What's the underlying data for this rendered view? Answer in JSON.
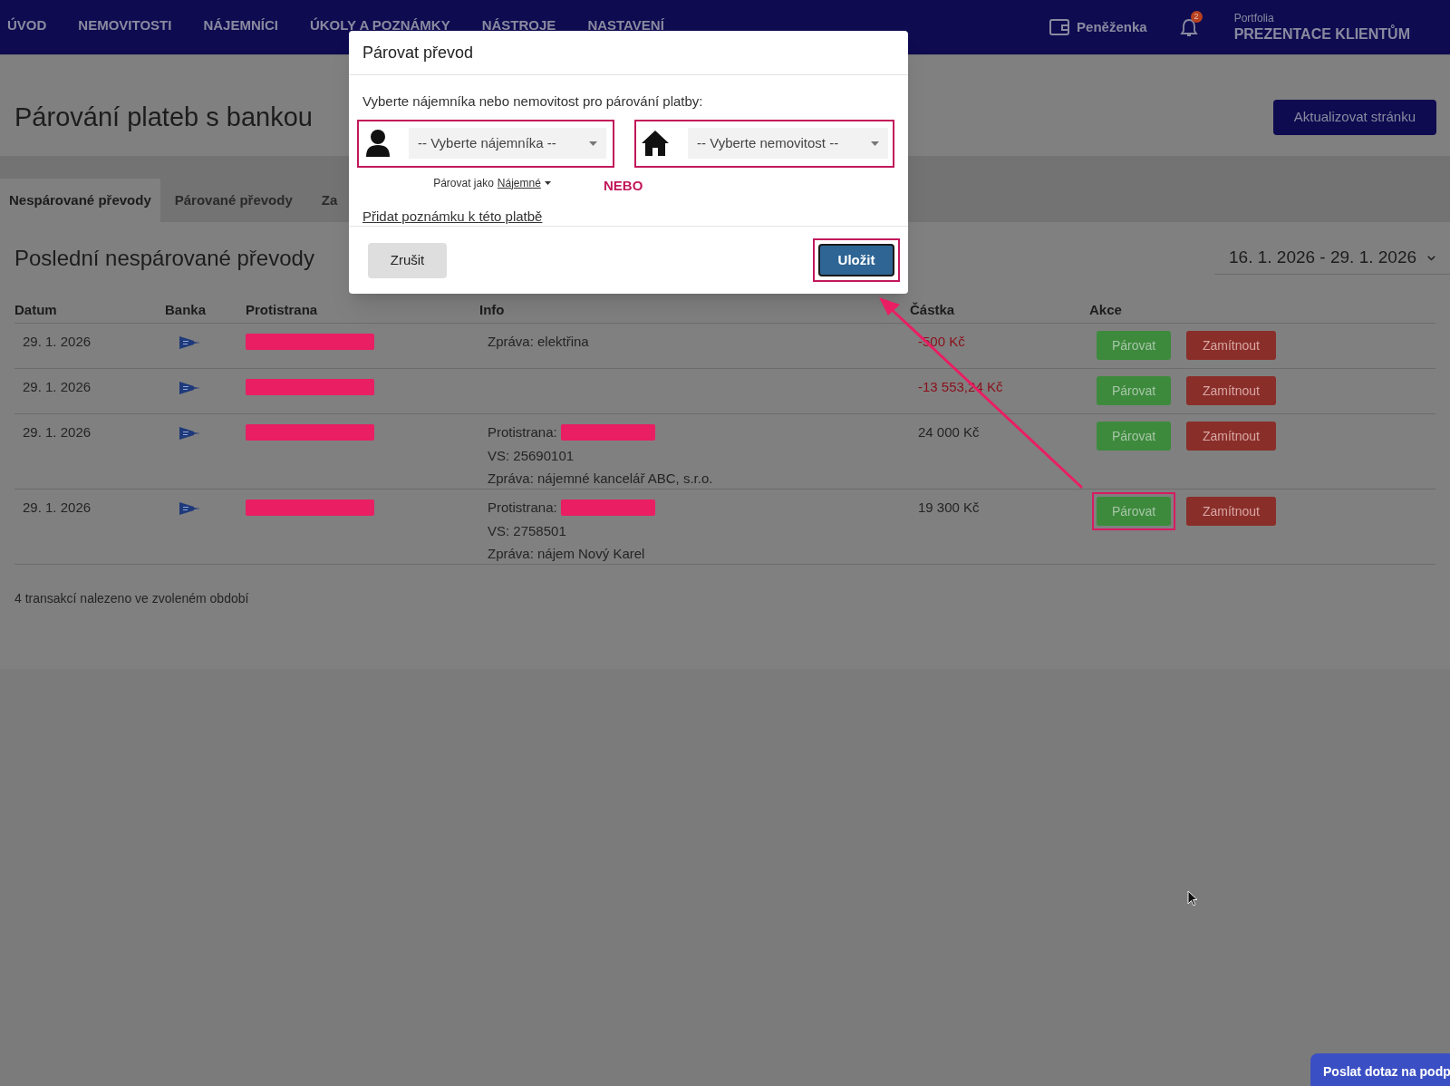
{
  "nav": {
    "items": [
      {
        "label": "ÚVOD"
      },
      {
        "label": "NEMOVITOSTI"
      },
      {
        "label": "NÁJEMNÍCI"
      },
      {
        "label": "ÚKOLY A POZNÁMKY"
      },
      {
        "label": "NÁSTROJE"
      },
      {
        "label": "NASTAVENÍ"
      }
    ],
    "wallet": "Peněženka",
    "notifications": "2",
    "portfolio_label": "Portfolia",
    "portfolio_name": "PREZENTACE KLIENTŮM"
  },
  "page_title": "Párování plateb s bankou",
  "refresh_button": "Aktualizovat stránku",
  "tabs": [
    {
      "label": "Nespárované převody",
      "selected": true
    },
    {
      "label": "Párované převody",
      "selected": false
    },
    {
      "label": "Za",
      "selected": false
    }
  ],
  "section_title": "Poslední nespárované převody",
  "date_range": "16. 1. 2026 - 29. 1. 2026",
  "table": {
    "columns": [
      "Datum",
      "Banka",
      "Protistrana",
      "Info",
      "Částka",
      "Akce"
    ],
    "rows": [
      {
        "date": "29. 1. 2026",
        "info": [
          {
            "text": "Zpráva: elektřina",
            "redacted": false
          }
        ],
        "amount": "-500 Kč",
        "negative": true,
        "actions": [
          {
            "label": "Párovat",
            "kind": "pair",
            "highlighted": false
          },
          {
            "label": "Zamítnout",
            "kind": "reject",
            "highlighted": false
          }
        ]
      },
      {
        "date": "29. 1. 2026",
        "info": [],
        "amount": "-13 553,24 Kč",
        "negative": true,
        "actions": [
          {
            "label": "Párovat",
            "kind": "pair",
            "highlighted": false
          },
          {
            "label": "Zamítnout",
            "kind": "reject",
            "highlighted": false
          }
        ]
      },
      {
        "date": "29. 1. 2026",
        "info": [
          {
            "text": "Protistrana:",
            "redacted": true
          },
          {
            "text": "VS: 25690101",
            "redacted": false
          },
          {
            "text": "Zpráva: nájemné kancelář ABC, s.r.o.",
            "redacted": false
          }
        ],
        "amount": "24 000 Kč",
        "negative": false,
        "actions": [
          {
            "label": "Párovat",
            "kind": "pair",
            "highlighted": false
          },
          {
            "label": "Zamítnout",
            "kind": "reject",
            "highlighted": false
          }
        ]
      },
      {
        "date": "29. 1. 2026",
        "info": [
          {
            "text": "Protistrana:",
            "redacted": true
          },
          {
            "text": "VS: 2758501",
            "redacted": false
          },
          {
            "text": "Zpráva: nájem Nový Karel",
            "redacted": false
          }
        ],
        "amount": "19 300 Kč",
        "negative": false,
        "actions": [
          {
            "label": "Párovat",
            "kind": "pair",
            "highlighted": true
          },
          {
            "label": "Zamítnout",
            "kind": "reject",
            "highlighted": false
          }
        ]
      }
    ]
  },
  "footer": "4 transakcí nalezeno ve zvoleném období",
  "modal": {
    "title": "Párovat převod",
    "prompt": "Vyberte nájemníka nebo nemovitost pro párování platby:",
    "tenant_select": {
      "placeholder": "-- Vyberte nájemníka --",
      "highlighted": true
    },
    "property_select": {
      "placeholder": "-- Vyberte nemovitost --",
      "highlighted": true
    },
    "match_as_label": "Párovat jako",
    "match_as_value": "Nájemné",
    "or_label": "NEBO",
    "note_link": "Přidat poznámku k této platbě",
    "cancel_button": "Zrušit",
    "save_button": {
      "label": "Uložit",
      "highlighted": true
    }
  },
  "support_button": "Poslat dotaz na podp"
}
